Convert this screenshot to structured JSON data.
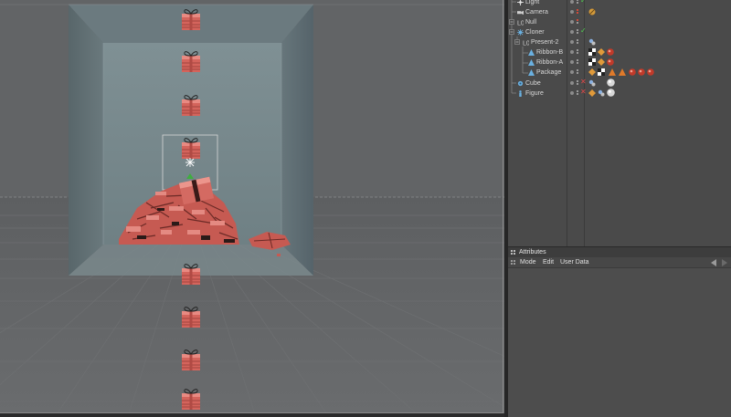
{
  "object_manager": {
    "objects": [
      {
        "name": "Light",
        "icon": "light-icon",
        "flag": "check",
        "tags": []
      },
      {
        "name": "Camera",
        "icon": "camera-icon",
        "flag": "none",
        "tags": [
          "camera-tag-icon"
        ]
      },
      {
        "name": "Null",
        "icon": "null-icon",
        "flag": "none",
        "tags": []
      },
      {
        "name": "Cloner",
        "icon": "cloner-icon",
        "flag": "check",
        "tags": []
      },
      {
        "name": "Present-2",
        "icon": "null-icon",
        "flag": "none",
        "tags": [
          "compositing-tag-icon"
        ]
      },
      {
        "name": "Ribbon-B",
        "icon": "sweep-icon",
        "flag": "none",
        "tags": [
          "texture-tag-icon",
          "phong-tag-icon",
          "material-tag-icon"
        ]
      },
      {
        "name": "Ribbon-A",
        "icon": "sweep-icon",
        "flag": "none",
        "tags": [
          "texture-tag-icon",
          "phong-tag-icon",
          "material-tag-icon"
        ]
      },
      {
        "name": "Package",
        "icon": "sweep-icon",
        "flag": "none",
        "tags": [
          "phong-tag-icon",
          "texture-tag-icon",
          "selection-tag-icon",
          "selection-tag-icon",
          "material-tag-icon",
          "material-tag-icon",
          "material-tag-icon"
        ]
      },
      {
        "name": "Cube",
        "icon": "cube-icon",
        "flag": "x",
        "tags": [
          "compositing-tag-icon",
          "material-tag-icon"
        ]
      },
      {
        "name": "Figure",
        "icon": "figure-icon",
        "flag": "x",
        "tags": [
          "phong-tag-icon",
          "compositing-tag-icon",
          "material-tag-icon"
        ]
      }
    ]
  },
  "attributes": {
    "title": "Attributes",
    "menu": [
      "Mode",
      "Edit",
      "User Data"
    ]
  },
  "colors": {
    "viewport_bg": "#606264",
    "room_wall": "#6a777c",
    "present_red": "#d4645c",
    "check_green": "#4fd14f",
    "x_red": "#e04848"
  }
}
